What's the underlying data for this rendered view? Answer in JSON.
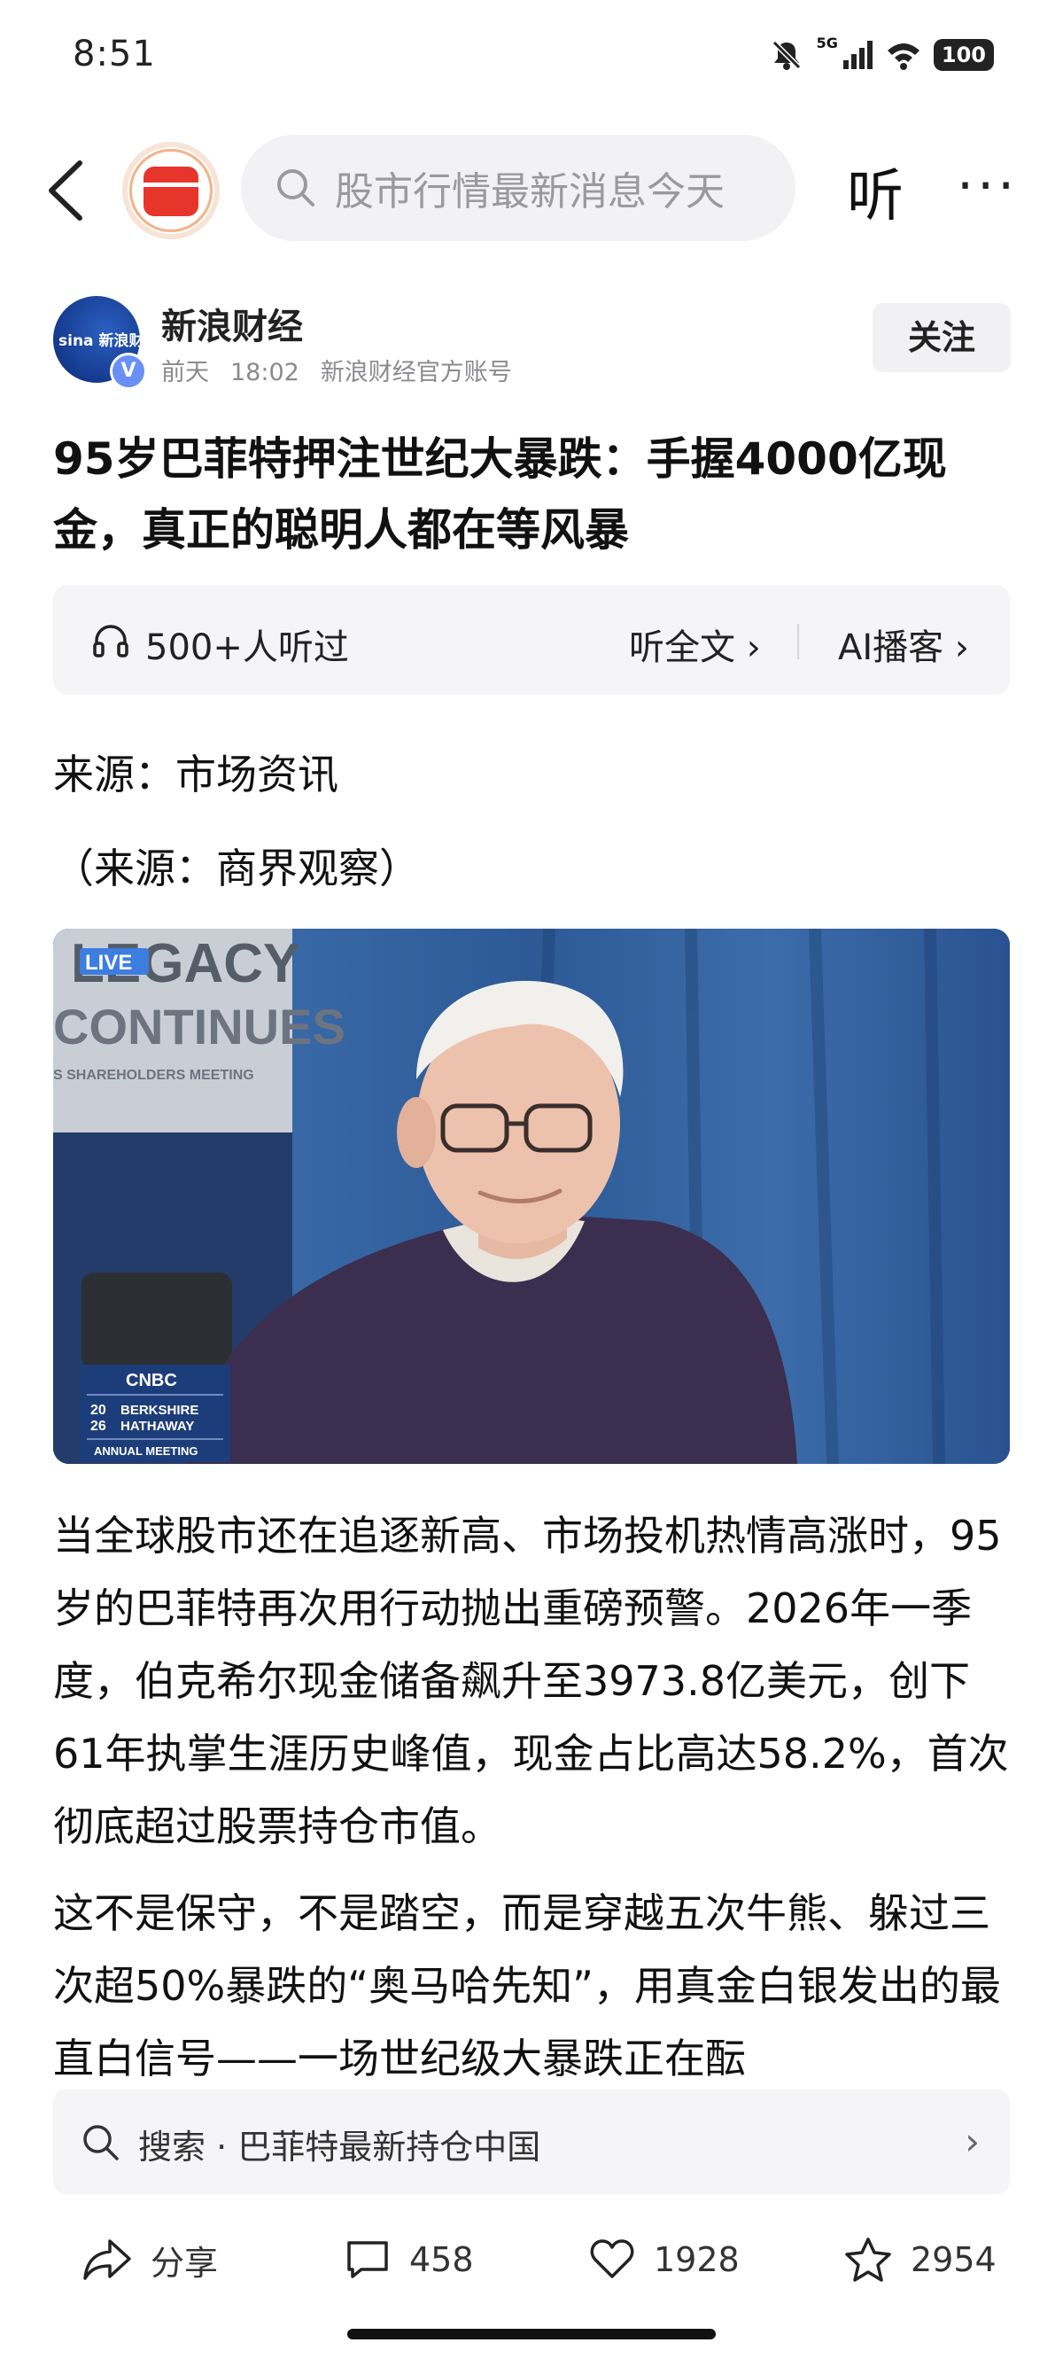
{
  "status_bar": {
    "time": "8:51",
    "network": "5G",
    "battery": "100"
  },
  "nav": {
    "search_placeholder": "股市行情最新消息今天",
    "listen_label": "听",
    "more_label": "···"
  },
  "author": {
    "avatar_text": "sina 新浪财经",
    "name": "新浪财经",
    "date": "前天",
    "time": "18:02",
    "account_type": "新浪财经官方账号",
    "follow_label": "关注"
  },
  "article": {
    "title": "95岁巴菲特押注世纪大暴跌：手握4000亿现金，真正的聪明人都在等风暴",
    "listen_count": "500+人听过",
    "listen_full": "听全文 ›",
    "ai_podcast": "AI播客 ›",
    "source_line": "来源：市场资讯",
    "source_line2": "（来源：商界观察）",
    "image_overlay": {
      "banner_top": "LEGACY",
      "banner_bottom": "CONTINUES",
      "banner_small": "S SHAREHOLDERS MEETING",
      "live": "LIVE",
      "cnbc": "CNBC",
      "year_top": "20",
      "year_bottom": "26",
      "company_line1": "BERKSHIRE",
      "company_line2": "HATHAWAY",
      "event": "ANNUAL MEETING"
    },
    "paragraph1": "当全球股市还在追逐新高、市场投机热情高涨时，95岁的巴菲特再次用行动抛出重磅预警。2026年一季度，伯克希尔现金储备飙升至3973.8亿美元，创下61年执掌生涯历史峰值，现金占比高达58.2%，首次彻底超过股票持仓市值。",
    "paragraph2": "这不是保守，不是踏空，而是穿越五次牛熊、躲过三次超50%暴跌的“奥马哈先知”，用真金白银发出的最直白信号——一场世纪级大暴跌正在酝"
  },
  "search_suggestion": {
    "label": "搜索",
    "separator": "·",
    "query": "巴菲特最新持仓中国",
    "arrow": "›"
  },
  "actions": {
    "share_label": "分享",
    "comments": "458",
    "likes": "1928",
    "favorites": "2954"
  }
}
